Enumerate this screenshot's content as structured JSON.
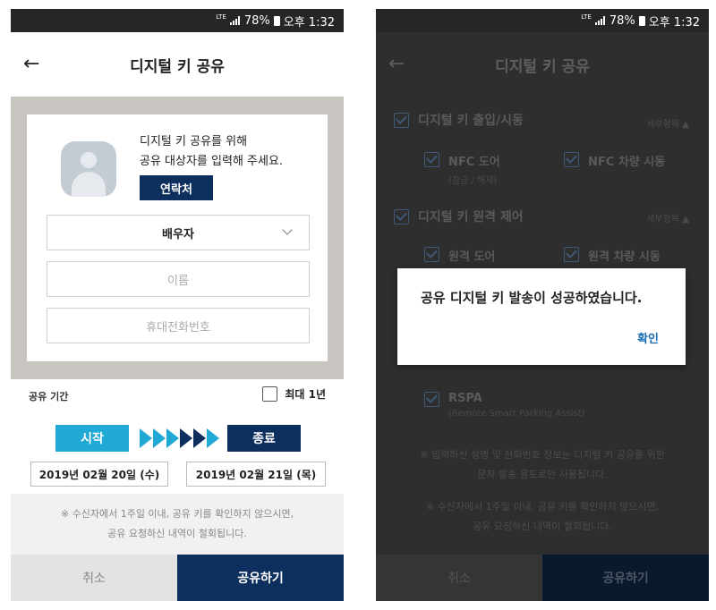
{
  "status_bar": {
    "network": "LTE",
    "battery": "78%",
    "time": "오후 1:32"
  },
  "left": {
    "title": "디지털 키 공유",
    "guide_line1": "디지털 키 공유를 위해",
    "guide_line2": "공유 대상자를 입력해 주세요.",
    "contact_button": "연락처",
    "relation_value": "배우자",
    "name_placeholder": "이름",
    "phone_placeholder": "휴대전화번호",
    "period_label": "공유 기간",
    "max_label": "최대 1년",
    "start_button": "시작",
    "end_button": "종료",
    "start_date": "2019년 02월 20일 (수)",
    "end_date": "2019년 02월 21일 (목)",
    "notice_line1": "※ 수신자에서 1주일 이내, 공유 키를 확인하지 않으시면,",
    "notice_line2": "공유 요청하신 내역이 철회됩니다.",
    "cancel_button": "취소",
    "share_button": "공유하기"
  },
  "right": {
    "title": "디지털 키 공유",
    "section1_label": "디지털 키 출입/시동",
    "section1_detail": "세부항목 ▲",
    "nfc_door": "NFC 도어",
    "nfc_door_caption": "(잠금 / 해제)",
    "nfc_start": "NFC 차량 시동",
    "section2_label": "디지털 키 원격 제어",
    "section2_detail": "세부항목 ▲",
    "remote_door": "원격 도어",
    "remote_start": "원격 차량 시동",
    "rspa_label": "RSPA",
    "rspa_caption": "(Remote Smart Parking Assist)",
    "info_line1": "※ 입력하신 성명 및 전화번호 정보는 디지털 키 공유를 위한",
    "info_line2": "문자 발송 용도로만 사용됩니다.",
    "notice_line1": "※ 수신자에서 1주일 이내, 공유 키를 확인하지 않으시면,",
    "notice_line2": "공유 요청하신 내역이 철회됩니다.",
    "cancel_button": "취소",
    "share_button": "공유하기",
    "dialog_message": "공유 디지털 키 발송이 성공하였습니다.",
    "dialog_ok": "확인"
  },
  "colors": {
    "navy": "#0c2f5e",
    "sky": "#21a9d6",
    "link": "#1c6fb5"
  }
}
